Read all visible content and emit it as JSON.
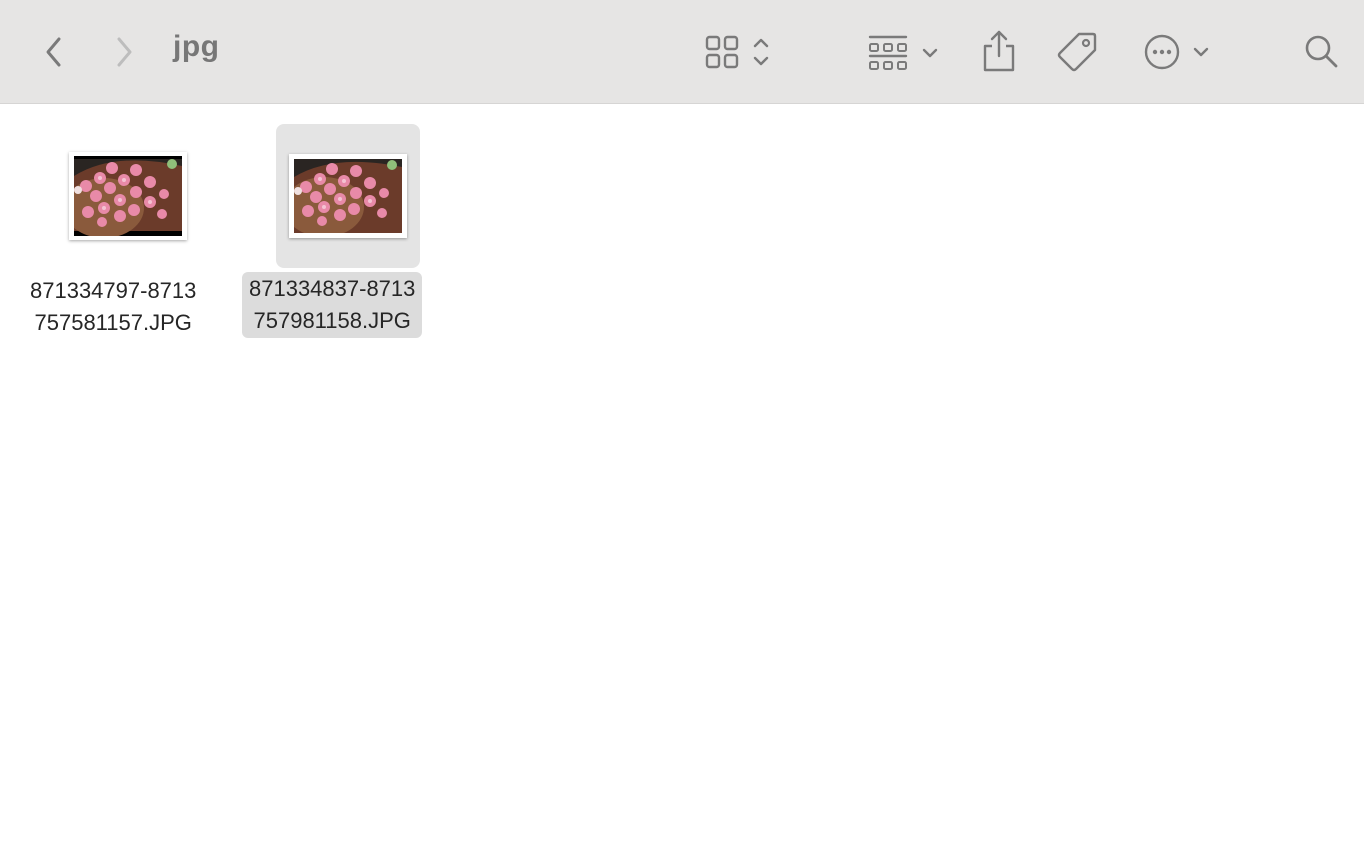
{
  "window": {
    "title": "jpg"
  },
  "toolbar": {
    "back_icon": "chevron-left-icon",
    "forward_icon": "chevron-right-icon",
    "view_icon": "icon-grid-view-icon",
    "group_icon": "group-by-icon",
    "share_icon": "share-icon",
    "tag_icon": "tag-icon",
    "more_icon": "ellipsis-circle-icon",
    "search_icon": "search-icon"
  },
  "files": [
    {
      "line1": "871334797-8713",
      "line2": "757581157.JPG",
      "selected": false
    },
    {
      "line1": "871334837-8713",
      "line2": "757981158.JPG",
      "selected": true
    }
  ],
  "colors": {
    "toolbar_bg": "#e6e5e4",
    "icon": "#7a7a7a",
    "icon_disabled": "#b8b8b8",
    "selection_bg": "#dcdcdc"
  }
}
